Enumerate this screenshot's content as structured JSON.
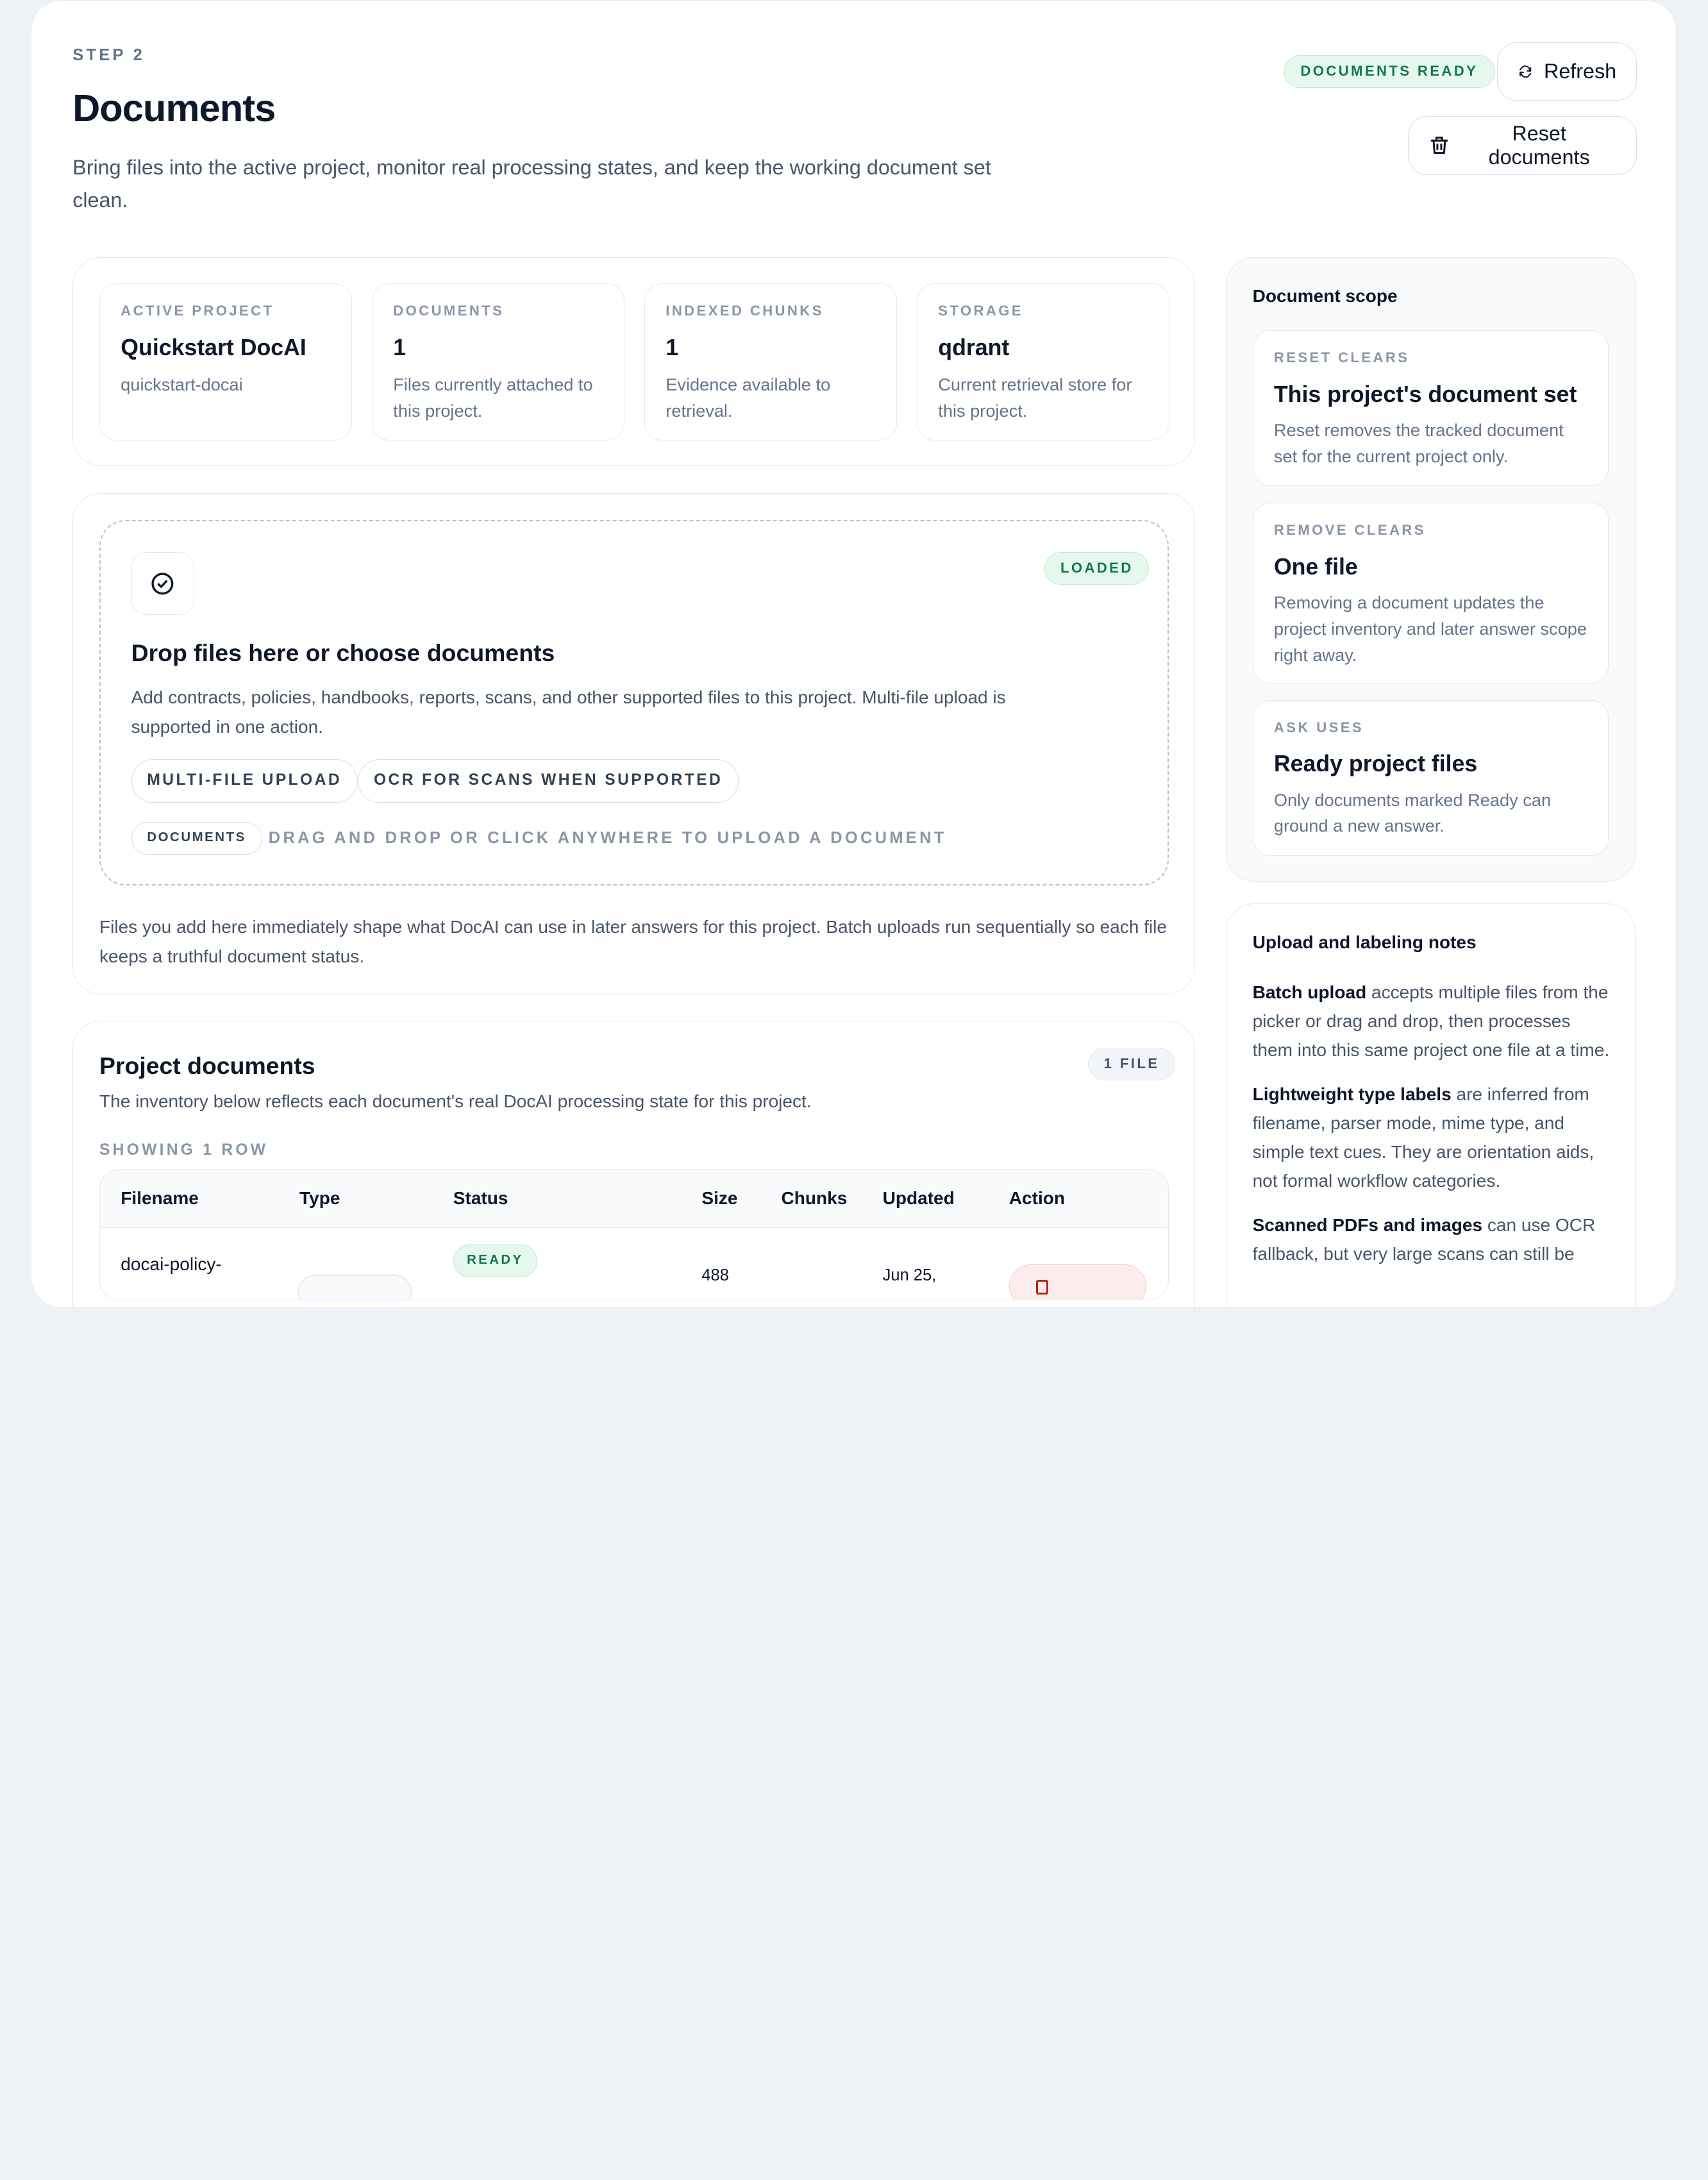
{
  "header": {
    "step": "STEP 2",
    "title": "Documents",
    "subtitle": "Bring files into the active project, monitor real processing states, and keep the working document set clean.",
    "status": "DOCUMENTS READY",
    "refresh_label": "Refresh",
    "reset_label": "Reset documents"
  },
  "stats": [
    {
      "label": "ACTIVE PROJECT",
      "value": "Quickstart DocAI",
      "sub": "quickstart-docai"
    },
    {
      "label": "DOCUMENTS",
      "value": "1",
      "sub": "Files currently attached to this project."
    },
    {
      "label": "INDEXED CHUNKS",
      "value": "1",
      "sub": "Evidence available to retrieval."
    },
    {
      "label": "STORAGE",
      "value": "qdrant",
      "sub": "Current retrieval store for this project."
    }
  ],
  "upload": {
    "badge": "LOADED",
    "title": "Drop files here or choose documents",
    "description": "Add contracts, policies, handbooks, reports, scans, and other supported files to this project. Multi-file upload is supported in one action.",
    "chips": [
      "MULTI-FILE UPLOAD",
      "OCR FOR SCANS WHEN SUPPORTED"
    ],
    "small_chip": "DOCUMENTS",
    "hint": "DRAG AND DROP OR CLICK ANYWHERE TO UPLOAD A DOCUMENT",
    "note": "Files you add here immediately shape what DocAI can use in later answers for this project. Batch uploads run sequentially so each file keeps a truthful document status."
  },
  "scope": {
    "title": "Document scope",
    "items": [
      {
        "label": "RESET CLEARS",
        "heading": "This project's document set",
        "text": "Reset removes the tracked document set for the current project only."
      },
      {
        "label": "REMOVE CLEARS",
        "heading": "One file",
        "text": "Removing a document updates the project inventory and later answer scope right away."
      },
      {
        "label": "ASK USES",
        "heading": "Ready project files",
        "text": "Only documents marked Ready can ground a new answer."
      }
    ]
  },
  "notes": {
    "title": "Upload and labeling notes",
    "items": [
      {
        "bold": "Batch upload",
        "text": " accepts multiple files from the picker or drag and drop, then processes them into this same project one file at a time."
      },
      {
        "bold": "Lightweight type labels",
        "text": " are inferred from filename, parser mode, mime type, and simple text cues. They are orientation aids, not formal workflow categories."
      },
      {
        "bold": "Scanned PDFs and images",
        "text": " can use OCR fallback, but very large scans can still be"
      }
    ]
  },
  "inventory": {
    "title": "Project documents",
    "subtitle": "The inventory below reflects each document's real DocAI processing state for this project.",
    "count": "1 FILE",
    "rows_label": "SHOWING 1 ROW",
    "columns": [
      "Filename",
      "Type",
      "Status",
      "Size",
      "Chunks",
      "Updated",
      "Action"
    ],
    "row": {
      "filename": "docai-policy-",
      "status": "READY",
      "size": "488",
      "updated": "Jun 25,"
    }
  }
}
